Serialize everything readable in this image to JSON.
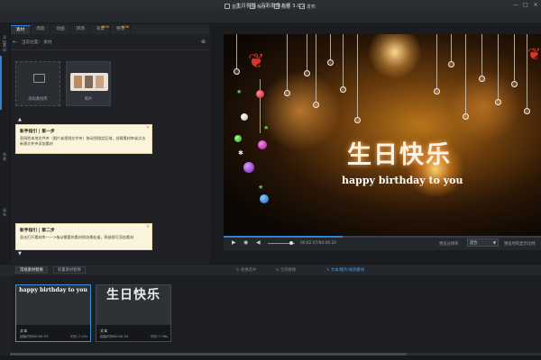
{
  "app": {
    "title": "生日祝福 - 万彩影像大师 3.0.2",
    "window_controls": [
      "—",
      "□",
      "✕"
    ]
  },
  "toolbar": {
    "items": [
      {
        "label": "首页",
        "icon": "home-icon"
      },
      {
        "label": "保存",
        "icon": "save-icon"
      },
      {
        "label": "预览",
        "icon": "preview-icon"
      },
      {
        "label": "发布",
        "icon": "publish-icon"
      }
    ]
  },
  "left_strip": {
    "items": [
      "添加素材",
      "场景",
      "画布"
    ]
  },
  "tabs": [
    {
      "label": "素材",
      "active": true
    },
    {
      "label": "场景",
      "active": false
    },
    {
      "label": "动画",
      "active": false
    },
    {
      "label": "转场",
      "active": false
    },
    {
      "label": "背景",
      "active": false,
      "badge": "NEW"
    },
    {
      "label": "特效",
      "active": false,
      "badge": "NEW"
    }
  ],
  "library": {
    "path": "当前位置： 素材",
    "tiles": [
      {
        "caption": "添加素材库"
      },
      {
        "caption": "照片"
      }
    ]
  },
  "guides": [
    {
      "title": "新手指引 | 第一步",
      "text": "直接把本地文件夹（图片或视频文件夹）拖动到指定区域，创建素材库或点击新建文件夹添加素材"
    },
    {
      "title": "新手指引 | 第二步",
      "text": "双击打开素材库——>拖动需要的素材到场景轨道，释放即可添加素材"
    }
  ],
  "preview": {
    "title": "生日快乐",
    "subtitle": "happy birthday to you",
    "timecode": "00:02.07/00:06.20",
    "ratio_label": "预览分辨率",
    "ratio_value": "适合",
    "fullsize_label": "预览时的显示比例",
    "progress": 0.375,
    "volume": 0.85
  },
  "timeline": {
    "tabs": [
      {
        "label": "常规素材替换",
        "active": true
      },
      {
        "label": "批量素材替换",
        "active": false
      }
    ],
    "buttons": [
      {
        "label": "替换选中",
        "icon": "replace-icon"
      },
      {
        "label": "全部替换",
        "icon": "replace-all-icon"
      },
      {
        "label": "文本/图片/视频素材",
        "icon": "pencil-icon"
      }
    ],
    "clips": [
      {
        "preview": "happy birthday to you",
        "type": "文本",
        "start": "起始时间00:00.53",
        "duration": "时长:7.42s"
      },
      {
        "preview": "生日快乐",
        "type": "文本",
        "start": "起始时间00:00.54",
        "duration": "时长:7.36s"
      }
    ]
  },
  "colors": {
    "accent": "#2f7fd4",
    "guide_bg": "#fbf4dc",
    "panel": "#1f2126"
  }
}
